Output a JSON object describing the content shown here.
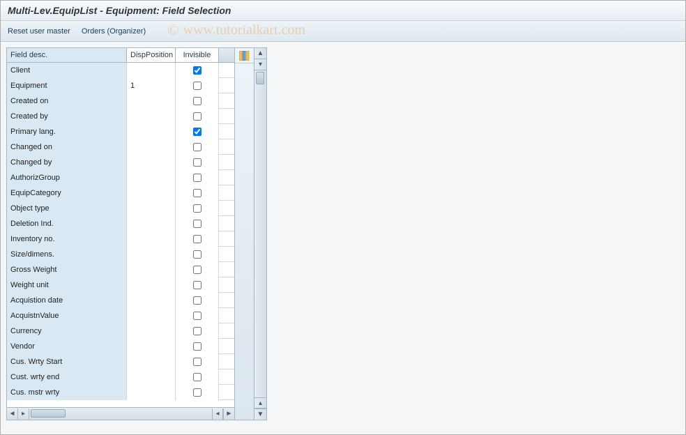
{
  "window": {
    "title": "Multi-Lev.EquipList - Equipment: Field Selection"
  },
  "toolbar": {
    "reset_label": "Reset user master",
    "orders_label": "Orders (Organizer)"
  },
  "table": {
    "headers": {
      "field_desc": "Field desc.",
      "disp_position": "DispPosition",
      "invisible": "Invisible"
    },
    "rows": [
      {
        "desc": "Client",
        "pos": "",
        "inv": true
      },
      {
        "desc": "Equipment",
        "pos": "1",
        "inv": false
      },
      {
        "desc": "Created on",
        "pos": "",
        "inv": false
      },
      {
        "desc": "Created by",
        "pos": "",
        "inv": false
      },
      {
        "desc": "Primary lang.",
        "pos": "",
        "inv": true
      },
      {
        "desc": "Changed on",
        "pos": "",
        "inv": false
      },
      {
        "desc": "Changed by",
        "pos": "",
        "inv": false
      },
      {
        "desc": "AuthorizGroup",
        "pos": "",
        "inv": false
      },
      {
        "desc": "EquipCategory",
        "pos": "",
        "inv": false
      },
      {
        "desc": "Object type",
        "pos": "",
        "inv": false
      },
      {
        "desc": "Deletion Ind.",
        "pos": "",
        "inv": false
      },
      {
        "desc": "Inventory no.",
        "pos": "",
        "inv": false
      },
      {
        "desc": "Size/dimens.",
        "pos": "",
        "inv": false
      },
      {
        "desc": "Gross Weight",
        "pos": "",
        "inv": false
      },
      {
        "desc": "Weight unit",
        "pos": "",
        "inv": false
      },
      {
        "desc": "Acquistion date",
        "pos": "",
        "inv": false
      },
      {
        "desc": "AcquistnValue",
        "pos": "",
        "inv": false
      },
      {
        "desc": "Currency",
        "pos": "",
        "inv": false
      },
      {
        "desc": "Vendor",
        "pos": "",
        "inv": false
      },
      {
        "desc": "Cus. Wrty Start",
        "pos": "",
        "inv": false
      },
      {
        "desc": "Cust. wrty end",
        "pos": "",
        "inv": false
      },
      {
        "desc": "Cus. mstr wrty",
        "pos": "",
        "inv": false
      }
    ]
  },
  "icons": {
    "layout_config": "columns-config-icon"
  },
  "watermark": {
    "text": "www.tutorialkart.com",
    "copyright": "©"
  }
}
